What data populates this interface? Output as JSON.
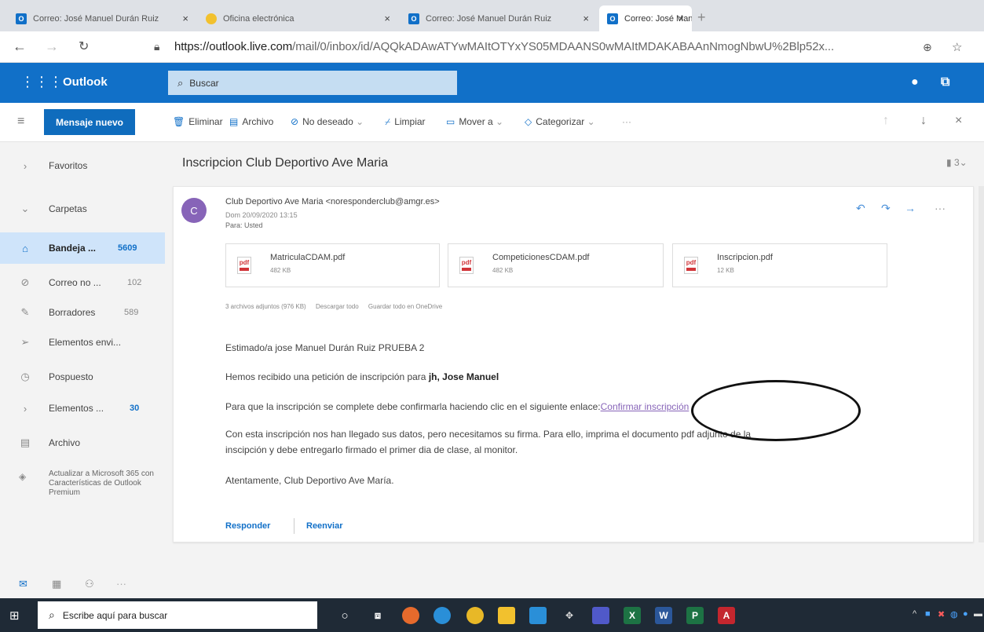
{
  "browser": {
    "tabs": [
      {
        "label": "Correo: José Manuel Durán Ruiz",
        "icon": "outlook-favicon",
        "color": "#1170c8"
      },
      {
        "label": "Oficina electrónica",
        "icon": "sun-favicon",
        "color": "#f2c12e"
      },
      {
        "label": "Correo: José Manuel Durán Ruiz",
        "icon": "outlook-favicon",
        "color": "#1170c8"
      },
      {
        "label": "Correo: José Manuel Durán Ruiz",
        "icon": "outlook-favicon",
        "color": "#1170c8"
      }
    ],
    "url_host": "https://outlook.live.com",
    "url_path": "/mail/0/inbox/id/AQQkADAwATYwMAItOTYxYS05MDAANS0wMAItMDAKABAAnNmogNbwU%2Blp52x..."
  },
  "outlook": {
    "brand": "Outlook",
    "search_placeholder": "Buscar",
    "accent": "#1170c8"
  },
  "commands": {
    "new_mail": "Mensaje nuevo",
    "delete": "Eliminar",
    "archive": "Archivo",
    "junk": "No deseado",
    "sweep": "Limpiar",
    "move": "Mover a",
    "categorize": "Categorizar",
    "more": "···"
  },
  "nav": {
    "favorites": "Favoritos",
    "folders": "Carpetas",
    "items": [
      {
        "label": "Bandeja ...",
        "count": "5609"
      },
      {
        "label": "Correo no ...",
        "count": "102"
      },
      {
        "label": "Borradores",
        "count": "589"
      },
      {
        "label": "Elementos envi...",
        "count": ""
      },
      {
        "label": "Pospuesto",
        "count": ""
      },
      {
        "label": "Elementos ...",
        "count": "30"
      },
      {
        "label": "Archivo",
        "count": ""
      }
    ],
    "promo": "Actualizar a Microsoft 365 con Características de Outlook Premium"
  },
  "message": {
    "subject": "Inscripcion Club Deportivo Ave Maria",
    "thread_count": "3",
    "avatar_letter": "C",
    "sender": "Club Deportivo Ave Maria <noresponderclub@amgr.es>",
    "date": "Dom 20/09/2020 13:15",
    "to": "Para: Usted",
    "attachments": [
      {
        "name": "MatriculaCDAM.pdf",
        "size": "482 KB"
      },
      {
        "name": "CompeticionesCDAM.pdf",
        "size": "482 KB"
      },
      {
        "name": "Inscripcion.pdf",
        "size": "12 KB"
      }
    ],
    "attachment_summary": "3 archivos adjuntos (976 KB)",
    "download_all": "Descargar todo",
    "save_onedrive": "Guardar todo en OneDrive",
    "greeting": "Estimado/a jose Manuel Durán Ruiz PRUEBA 2",
    "line1_pre": "Hemos recibido una petición de inscripción para ",
    "line1_bold": "jh, Jose Manuel",
    "line2_pre": "Para que la inscripción se complete debe confirmarla haciendo clic en el siguiente enlace:",
    "confirm_link": "Confirmar inscripción",
    "line3a": "Con esta inscripción nos han llegado sus datos, pero necesitamos su firma. Para ello, imprima el documento pdf adjunto de la",
    "line3b": "inscipción y debe entregarlo firmado el primer dia de clase, al monitor.",
    "signoff": "Atentamente, Club Deportivo Ave María.",
    "reply": "Responder",
    "forward": "Reenviar"
  },
  "taskbar": {
    "search_placeholder": "Escribe aquí para buscar"
  }
}
